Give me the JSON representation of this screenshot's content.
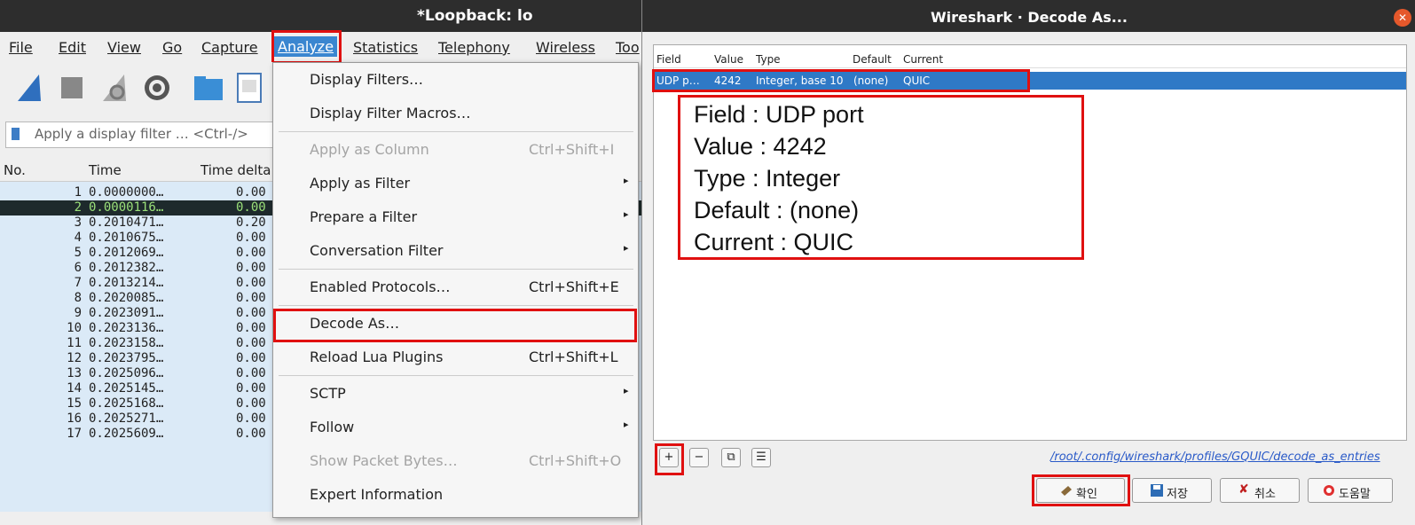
{
  "left_window": {
    "title": "*Loopback: lo",
    "menu_bar": [
      "File",
      "Edit",
      "View",
      "Go",
      "Capture",
      "Analyze",
      "Statistics",
      "Telephony",
      "Wireless",
      "Too"
    ],
    "filter_placeholder": "Apply a display filter … <Ctrl-/>",
    "columns": [
      "No.",
      "Time",
      "Time delta"
    ],
    "packets": [
      {
        "no": "1",
        "time": "0.0000000…",
        "delta": "0.00"
      },
      {
        "no": "2",
        "time": "0.0000116…",
        "delta": "0.00"
      },
      {
        "no": "3",
        "time": "0.2010471…",
        "delta": "0.20"
      },
      {
        "no": "4",
        "time": "0.2010675…",
        "delta": "0.00"
      },
      {
        "no": "5",
        "time": "0.2012069…",
        "delta": "0.00"
      },
      {
        "no": "6",
        "time": "0.2012382…",
        "delta": "0.00"
      },
      {
        "no": "7",
        "time": "0.2013214…",
        "delta": "0.00"
      },
      {
        "no": "8",
        "time": "0.2020085…",
        "delta": "0.00"
      },
      {
        "no": "9",
        "time": "0.2023091…",
        "delta": "0.00"
      },
      {
        "no": "10",
        "time": "0.2023136…",
        "delta": "0.00"
      },
      {
        "no": "11",
        "time": "0.2023158…",
        "delta": "0.00"
      },
      {
        "no": "12",
        "time": "0.2023795…",
        "delta": "0.00"
      },
      {
        "no": "13",
        "time": "0.2025096…",
        "delta": "0.00"
      },
      {
        "no": "14",
        "time": "0.2025145…",
        "delta": "0.00"
      },
      {
        "no": "15",
        "time": "0.2025168…",
        "delta": "0.00"
      },
      {
        "no": "16",
        "time": "0.2025271…",
        "delta": "0.00"
      },
      {
        "no": "17",
        "time": "0.2025609…",
        "delta": "0.00"
      }
    ],
    "selected_packet": "2"
  },
  "analyze_menu": {
    "items": [
      {
        "label": "Display Filters…",
        "shortcut": "",
        "submenu": false,
        "disabled": false
      },
      {
        "label": "Display Filter Macros…",
        "shortcut": "",
        "submenu": false,
        "disabled": false
      },
      {
        "label": "Apply as Column",
        "shortcut": "Ctrl+Shift+I",
        "submenu": false,
        "disabled": true
      },
      {
        "label": "Apply as Filter",
        "shortcut": "",
        "submenu": true,
        "disabled": false
      },
      {
        "label": "Prepare a Filter",
        "shortcut": "",
        "submenu": true,
        "disabled": false
      },
      {
        "label": "Conversation Filter",
        "shortcut": "",
        "submenu": true,
        "disabled": false
      },
      {
        "label": "Enabled Protocols…",
        "shortcut": "Ctrl+Shift+E",
        "submenu": false,
        "disabled": false
      },
      {
        "label": "Decode As…",
        "shortcut": "",
        "submenu": false,
        "disabled": false
      },
      {
        "label": "Reload Lua Plugins",
        "shortcut": "Ctrl+Shift+L",
        "submenu": false,
        "disabled": false
      },
      {
        "label": "SCTP",
        "shortcut": "",
        "submenu": true,
        "disabled": false
      },
      {
        "label": "Follow",
        "shortcut": "",
        "submenu": true,
        "disabled": false
      },
      {
        "label": "Show Packet Bytes…",
        "shortcut": "Ctrl+Shift+O",
        "submenu": false,
        "disabled": true
      },
      {
        "label": "Expert Information",
        "shortcut": "",
        "submenu": false,
        "disabled": false
      }
    ]
  },
  "dialog": {
    "title": "Wireshark · Decode As...",
    "columns": [
      "Field",
      "Value",
      "Type",
      "Default",
      "Current"
    ],
    "row": {
      "field": "UDP p…",
      "value": "4242",
      "type": "Integer, base 10",
      "default": "(none)",
      "current": "QUIC"
    },
    "annotation": [
      "Field : UDP port",
      "Value : 4242",
      "Type : Integer",
      "Default : (none)",
      "Current : QUIC"
    ],
    "small_buttons": [
      "+",
      "−",
      "⧉",
      "☰"
    ],
    "path": "/root/.config/wireshark/profiles/GQUIC/decode_as_entries",
    "buttons": {
      "ok": "확인",
      "save": "저장",
      "cancel": "취소",
      "help": "도움말"
    }
  },
  "colors": {
    "highlight": "#e01010",
    "selection": "#2f79c6",
    "packet_bg": "#dbeaf7"
  }
}
